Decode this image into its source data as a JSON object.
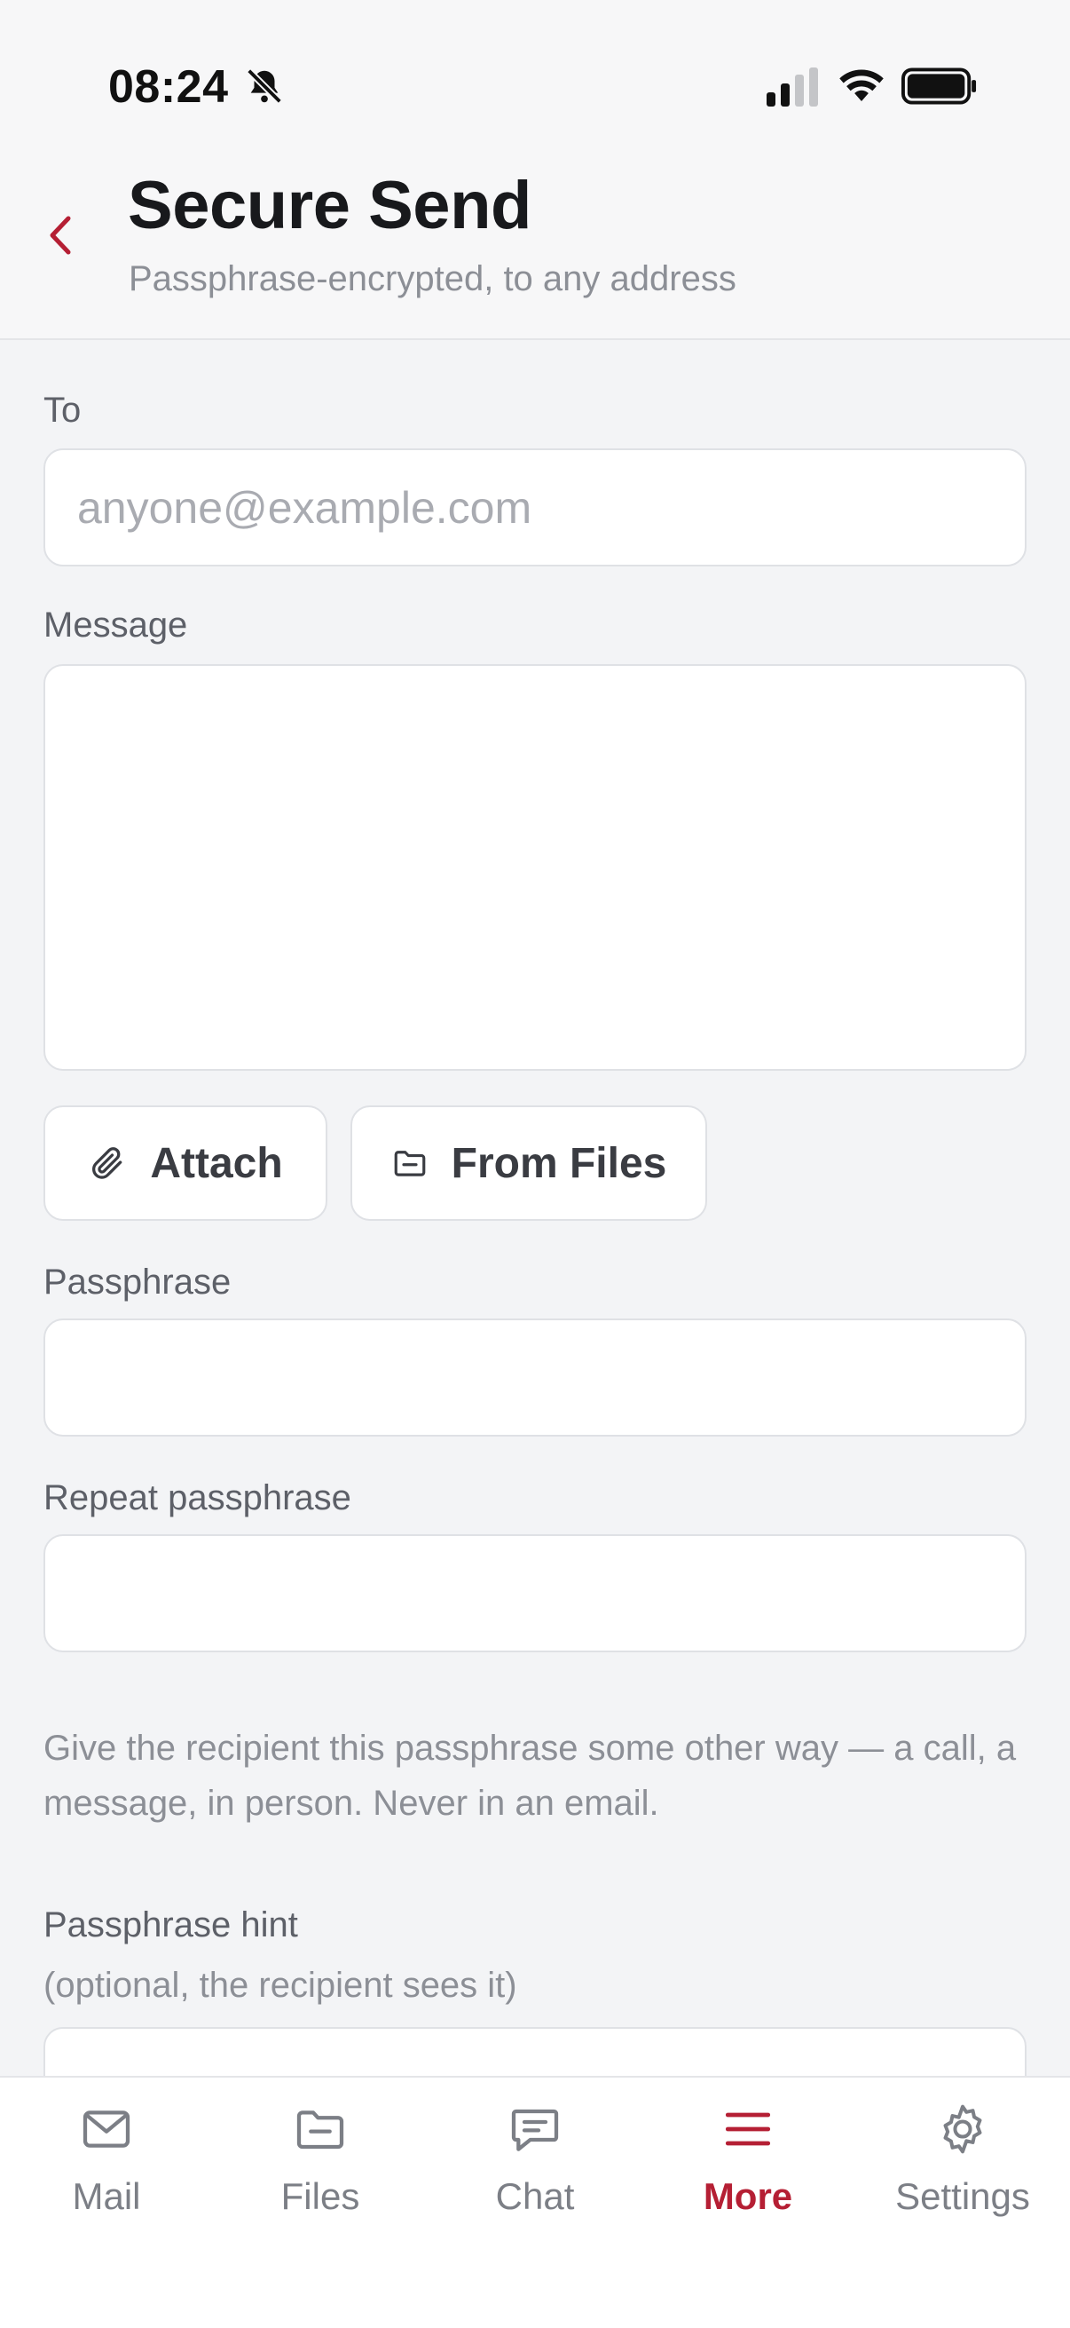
{
  "status_bar": {
    "time": "08:24",
    "icons": [
      "silent-bell-icon",
      "cellular-signal-icon",
      "wifi-icon",
      "battery-icon"
    ]
  },
  "header": {
    "title": "Secure Send",
    "subtitle": "Passphrase-encrypted, to any address",
    "back_icon": "chevron-left-icon"
  },
  "form": {
    "to_label": "To",
    "to_placeholder": "anyone@example.com",
    "to_value": "",
    "message_label": "Message",
    "message_value": "",
    "attach_label": "Attach",
    "from_files_label": "From Files",
    "passphrase_label": "Passphrase",
    "passphrase_value": "",
    "repeat_label": "Repeat passphrase",
    "repeat_value": "",
    "helper_text": "Give the recipient this passphrase some other way — a call, a message, in person. Never in an email.",
    "hint_label": "Passphrase hint",
    "hint_sublabel": "(optional, the recipient sees it)"
  },
  "tabs": [
    {
      "label": "Mail",
      "icon": "mail-icon",
      "active": false
    },
    {
      "label": "Files",
      "icon": "folder-icon",
      "active": false
    },
    {
      "label": "Chat",
      "icon": "chat-icon",
      "active": false
    },
    {
      "label": "More",
      "icon": "menu-icon",
      "active": true
    },
    {
      "label": "Settings",
      "icon": "gear-icon",
      "active": false
    }
  ],
  "colors": {
    "accent": "#b51f34",
    "background": "#f3f4f6",
    "muted_text": "#8c8f96"
  }
}
